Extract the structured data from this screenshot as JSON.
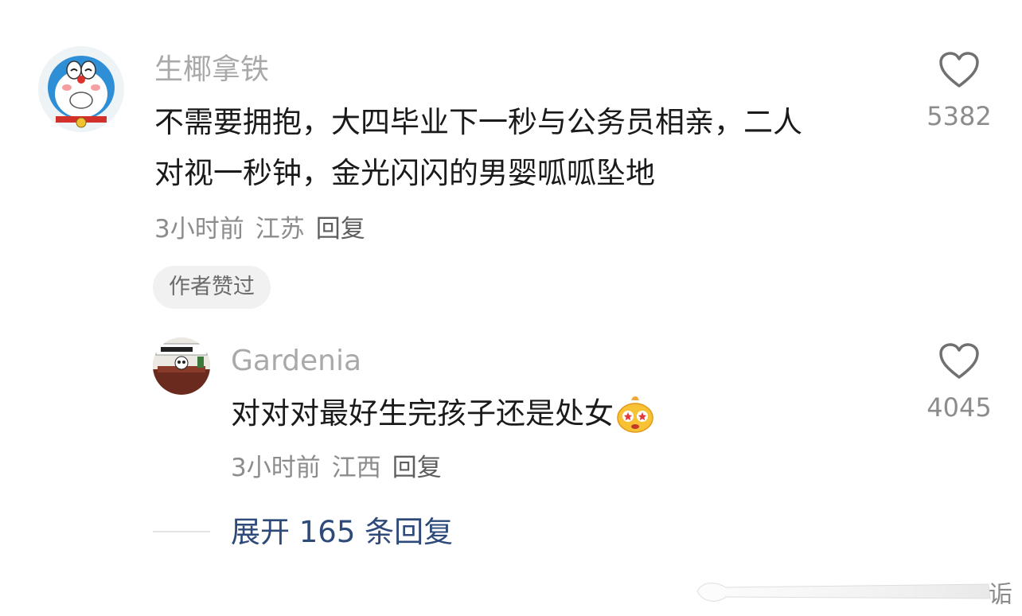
{
  "comment": {
    "username": "生椰拿铁",
    "text_line1": "不需要拥抱，大四毕业下一秒与公务员相亲，二人",
    "text_line2": "对视一秒钟，金光闪闪的男婴呱呱坠地",
    "time": "3小时前",
    "location": "江苏",
    "reply_label": "回复",
    "badge": "作者赞过",
    "likes": "5382",
    "avatar_icon": "doraemon-avatar-icon"
  },
  "reply": {
    "username": "Gardenia",
    "text": "对对对最好生完孩子还是处女",
    "emoji_icon": "star-eyes-emoji-icon",
    "time": "3小时前",
    "location": "江西",
    "reply_label": "回复",
    "likes": "4045",
    "avatar_icon": "panda-desk-avatar-icon"
  },
  "expand": {
    "label": "展开 165 条回复"
  },
  "watermark": {
    "char": "诟"
  },
  "colors": {
    "username": "#a9a9a9",
    "text": "#1a1a1a",
    "meta": "#8c8c8c",
    "expand_link": "#2d4a7a",
    "badge_bg": "#f1f1f1"
  }
}
